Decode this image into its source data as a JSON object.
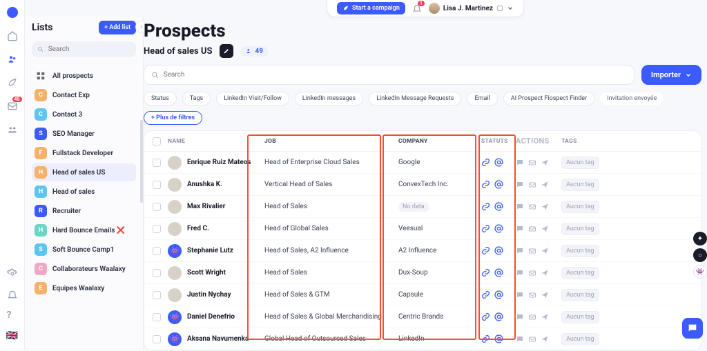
{
  "topbar": {
    "start_campaign": "Start a campaign",
    "notif_count": "1",
    "user_name": "Lisa J. Martinez"
  },
  "rail": {
    "badge": "45"
  },
  "sidebar": {
    "title": "Lists",
    "add_list": "+  Add list",
    "search_placeholder": "Search",
    "all_prospects": "All prospects",
    "items": [
      {
        "initial": "C",
        "color": "#f6b26b",
        "label": "Contact Exp"
      },
      {
        "initial": "C",
        "color": "#5ec5ef",
        "label": "Contact 3"
      },
      {
        "initial": "S",
        "color": "#3b5bfd",
        "label": "SEO Manager"
      },
      {
        "initial": "F",
        "color": "#f6b26b",
        "label": "Fullstack Developer"
      },
      {
        "initial": "H",
        "color": "#f6b26b",
        "label": "Head of sales US"
      },
      {
        "initial": "H",
        "color": "#5ec5ef",
        "label": "Head of sales"
      },
      {
        "initial": "R",
        "color": "#3b5bfd",
        "label": "Recruiter"
      },
      {
        "initial": "H",
        "color": "#6bd6c6",
        "label": "Hard Bounce Emails ❌"
      },
      {
        "initial": "S",
        "color": "#5ec5ef",
        "label": "Soft Bounce Camp1"
      },
      {
        "initial": "C",
        "color": "#f0a8c0",
        "label": "Collaborateurs Waalaxy"
      },
      {
        "initial": "E",
        "color": "#f6b26b",
        "label": "Equipes Waalaxy"
      }
    ],
    "selected_index": 4
  },
  "page": {
    "title": "Prospects",
    "list_name": "Head of sales US",
    "count": "49",
    "search_placeholder": "Search",
    "import": "Importer",
    "filters": [
      "Status",
      "Tags",
      "LinkedIn Visit/Follow",
      "LinkedIn messages",
      "LinkedIn Message Requests",
      "Email",
      "AI Prospect Fiospect Finder"
    ],
    "inv_sent": "Invitation envoyée",
    "more_filters": "+  Plus de filtres"
  },
  "table": {
    "headers": {
      "name": "NAME",
      "job": "JOB",
      "company": "COMPANY",
      "status": "STATUTS",
      "actions": "ACTIONS",
      "tags": "TAGS"
    },
    "tag_btn": "Aucun tag",
    "no_data": "No data",
    "rows": [
      {
        "name": "Enrique Ruiz Mateos",
        "job": "Head of Enterprise Cloud Sales",
        "company": "Google",
        "alien": false
      },
      {
        "name": "Anushka K.",
        "job": "Vertical Head of Sales",
        "company": "ConvexTech Inc.",
        "alien": false
      },
      {
        "name": "Max Rivalier",
        "job": "Head of Sales",
        "company": "",
        "alien": false,
        "nodata": true
      },
      {
        "name": "Fred C.",
        "job": "Head of Global Sales",
        "company": "Veesual",
        "alien": false
      },
      {
        "name": "Stephanie Lutz",
        "job": "Head of Sales, A2 Influence",
        "company": "A2 Influence",
        "alien": true
      },
      {
        "name": "Scott Wright",
        "job": "Head of Sales",
        "company": "Dux-Soup",
        "alien": false
      },
      {
        "name": "Justin Nychay",
        "job": "Head of Sales & GTM",
        "company": "Capsule",
        "alien": false
      },
      {
        "name": "Daniel Denefrio",
        "job": "Head of Sales & Global Merchandising",
        "company": "Centric Brands",
        "alien": true
      },
      {
        "name": "Aksana Navumenka",
        "job": "Global Head of Outsourced Sales",
        "company": "LinkedIn",
        "alien": true
      }
    ]
  }
}
